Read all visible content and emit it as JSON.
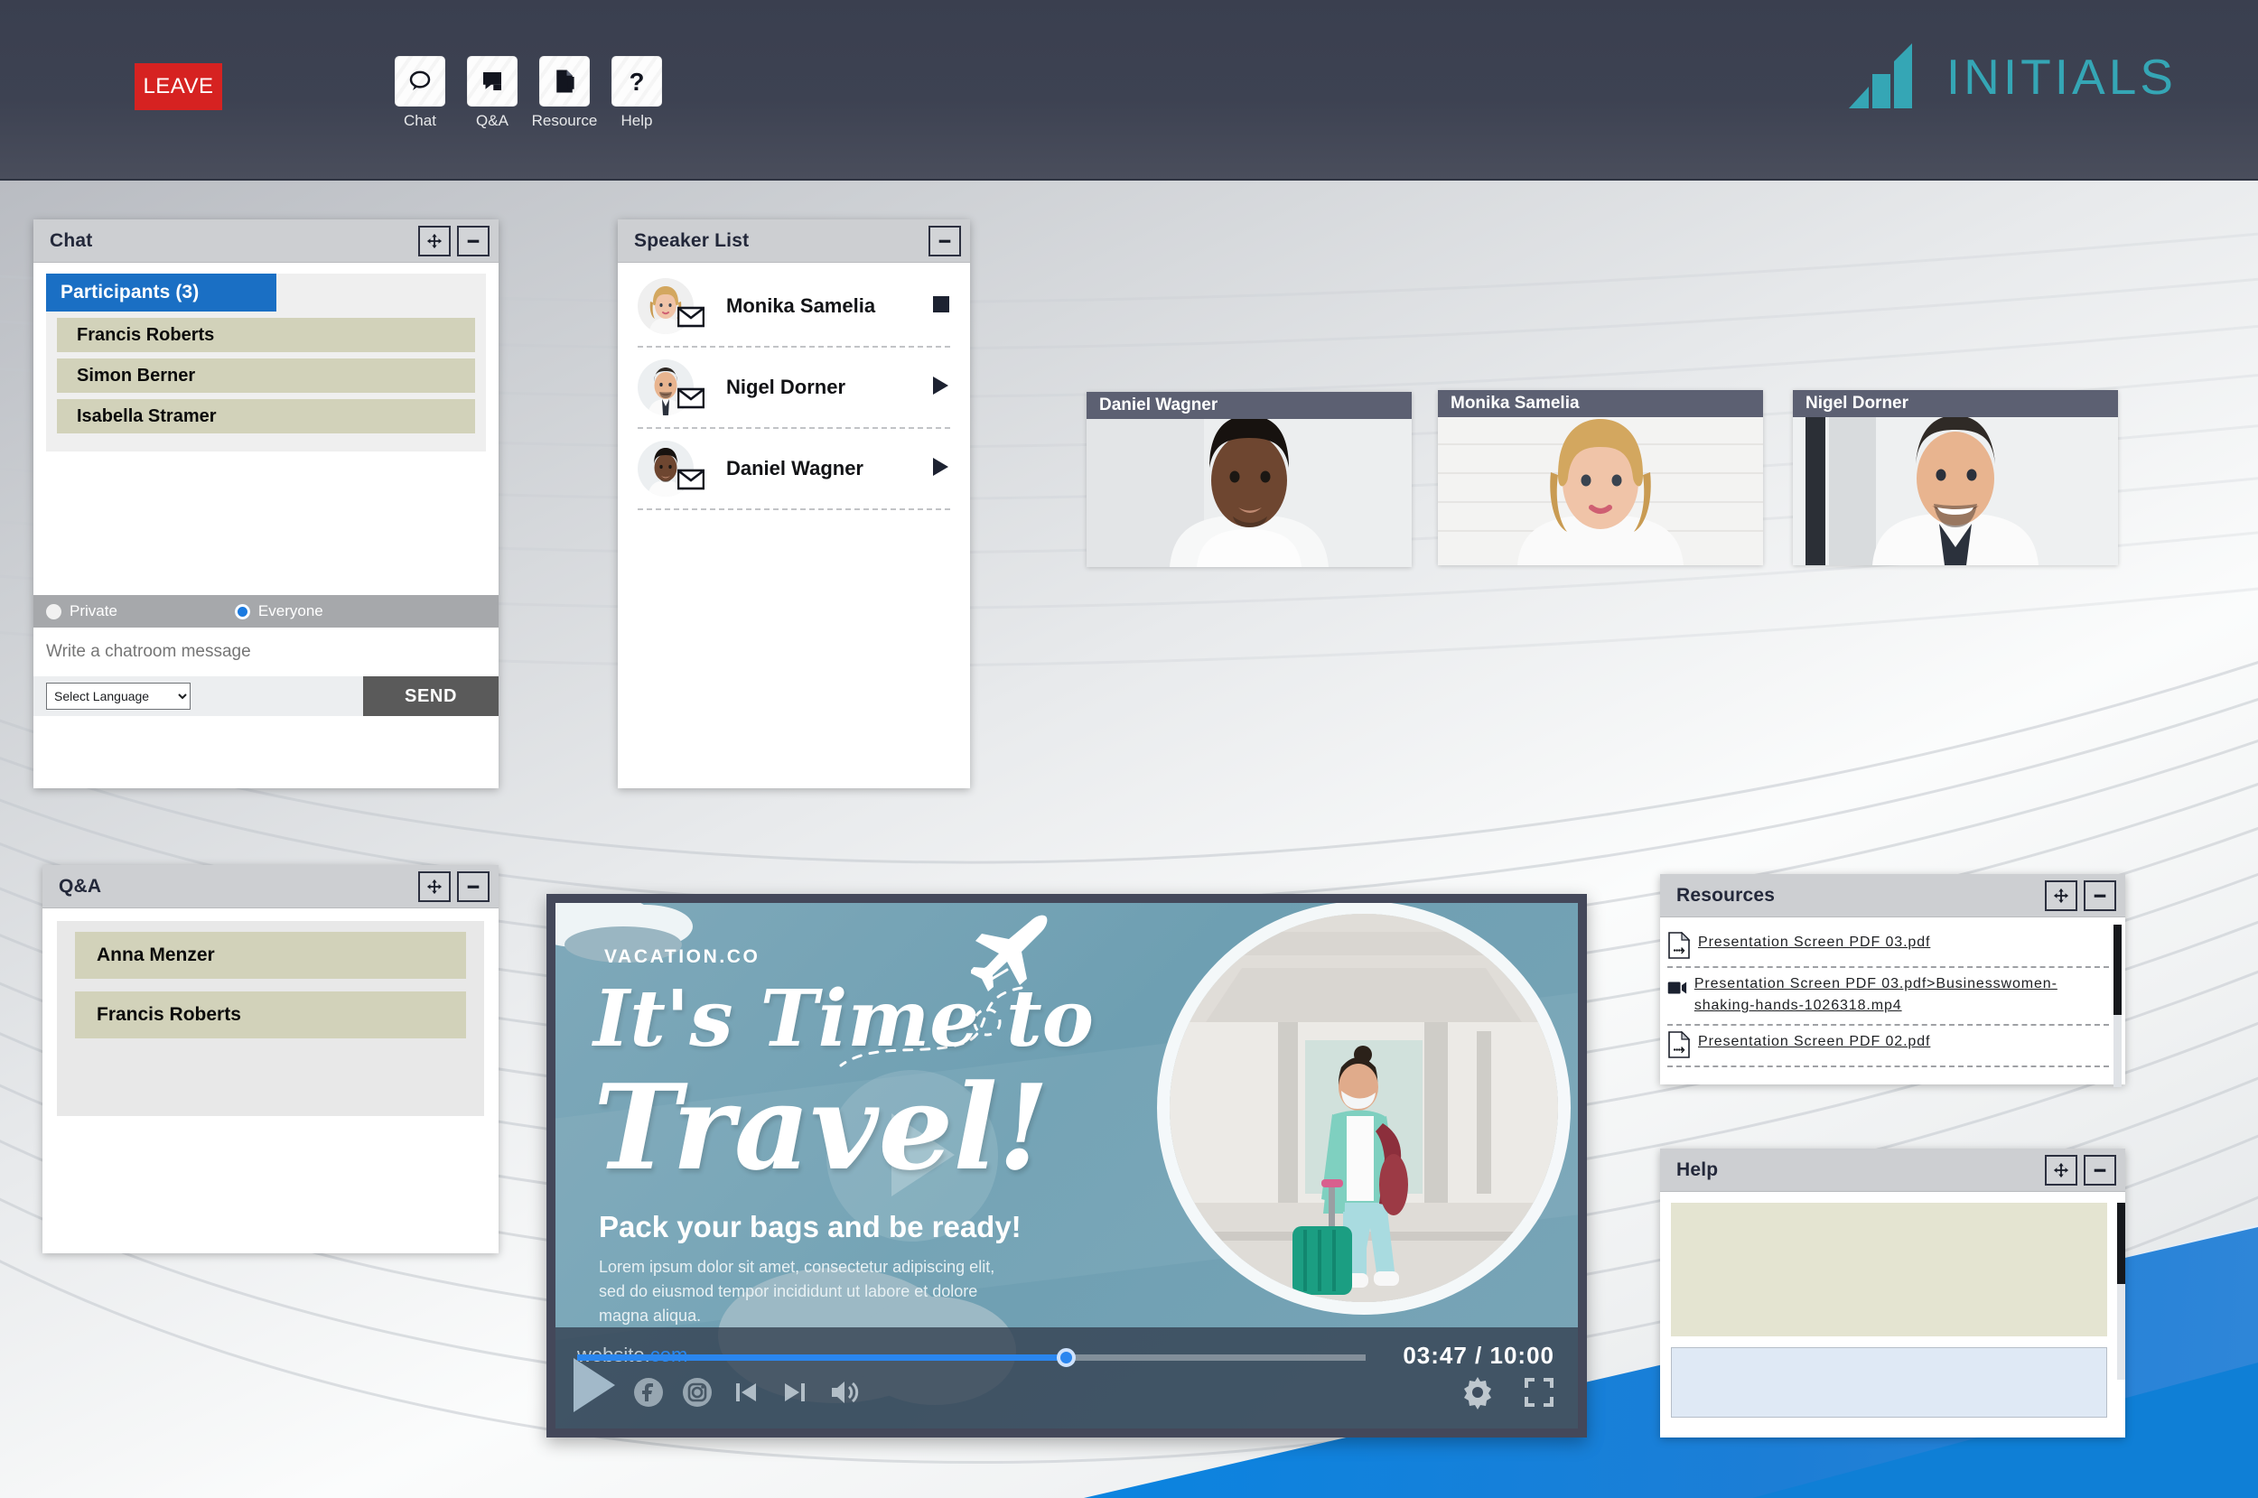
{
  "header": {
    "leave_label": "LEAVE",
    "nav": [
      {
        "label": "Chat",
        "icon": "chat-bubble-icon"
      },
      {
        "label": "Q&A",
        "icon": "qa-bubble-icon"
      },
      {
        "label": "Resource",
        "icon": "documents-icon"
      },
      {
        "label": "Help",
        "icon": "question-mark-icon"
      }
    ],
    "logo_text": "INITIALS",
    "logo_icon": "bar-chart-logo-icon",
    "brand_color": "#35a6b5",
    "leave_color": "#d62221",
    "bar_color": "#3d4252"
  },
  "chat": {
    "title": "Chat",
    "participants_label": "Participants (3)",
    "participants": [
      "Francis Roberts",
      "Simon Berner",
      "Isabella Stramer"
    ],
    "audience": [
      {
        "label": "Private",
        "selected": false
      },
      {
        "label": "Everyone",
        "selected": true
      }
    ],
    "message_placeholder": "Write a chatroom message",
    "message_value": "",
    "language_selected": "Select Language",
    "language_options": [
      "Select Language"
    ],
    "send_label": "SEND",
    "accent_color": "#1a6fc4",
    "row_color": "#d2d2ba"
  },
  "speaker_list": {
    "title": "Speaker List",
    "speakers": [
      {
        "name": "Monika Samelia",
        "state": "stop",
        "mail_icon": "envelope-icon"
      },
      {
        "name": "Nigel Dorner",
        "state": "play",
        "mail_icon": "envelope-icon"
      },
      {
        "name": "Daniel Wagner",
        "state": "play",
        "mail_icon": "envelope-icon"
      }
    ]
  },
  "qa": {
    "title": "Q&A",
    "entries": [
      "Anna Menzer",
      "Francis Roberts"
    ]
  },
  "resources": {
    "title": "Resources",
    "items": [
      {
        "name": "Presentation Screen PDF 03.pdf",
        "type": "pdf"
      },
      {
        "name": "Presentation Screen PDF 03.pdf>Businesswomen-shaking-hands-1026318.mp4",
        "type": "video"
      },
      {
        "name": "Presentation Screen PDF 02.pdf",
        "type": "pdf"
      }
    ]
  },
  "help": {
    "title": "Help",
    "message_value": "",
    "input_value": ""
  },
  "video_tiles": [
    {
      "name": "Daniel Wagner"
    },
    {
      "name": "Monika Samelia"
    },
    {
      "name": "Nigel Dorner"
    }
  ],
  "player": {
    "brand": "VACATION.CO",
    "headline_1": "It's Time to",
    "headline_2": "Travel!",
    "subhead": "Pack your bags and be ready!",
    "body": "Lorem ipsum dolor sit amet, consectetur adipiscing elit, sed do eiusmod tempor incididunt ut labore et dolore magna aliqua.",
    "website_prefix": "website.",
    "website_suffix": "com",
    "current_time": "03:47",
    "total_time": "10:00",
    "time_display": "03:47 / 10:00",
    "progress_percent": 62,
    "controls": [
      {
        "icon": "play-icon",
        "label": "Play"
      },
      {
        "icon": "facebook-icon",
        "label": "Facebook"
      },
      {
        "icon": "instagram-icon",
        "label": "Instagram"
      },
      {
        "icon": "previous-track-icon",
        "label": "Previous"
      },
      {
        "icon": "next-track-icon",
        "label": "Next"
      },
      {
        "icon": "volume-icon",
        "label": "Volume"
      },
      {
        "icon": "settings-gear-icon",
        "label": "Settings"
      },
      {
        "icon": "fullscreen-icon",
        "label": "Fullscreen"
      }
    ]
  },
  "panel_buttons": {
    "move": "move-icon",
    "minimize": "minimize-icon"
  }
}
